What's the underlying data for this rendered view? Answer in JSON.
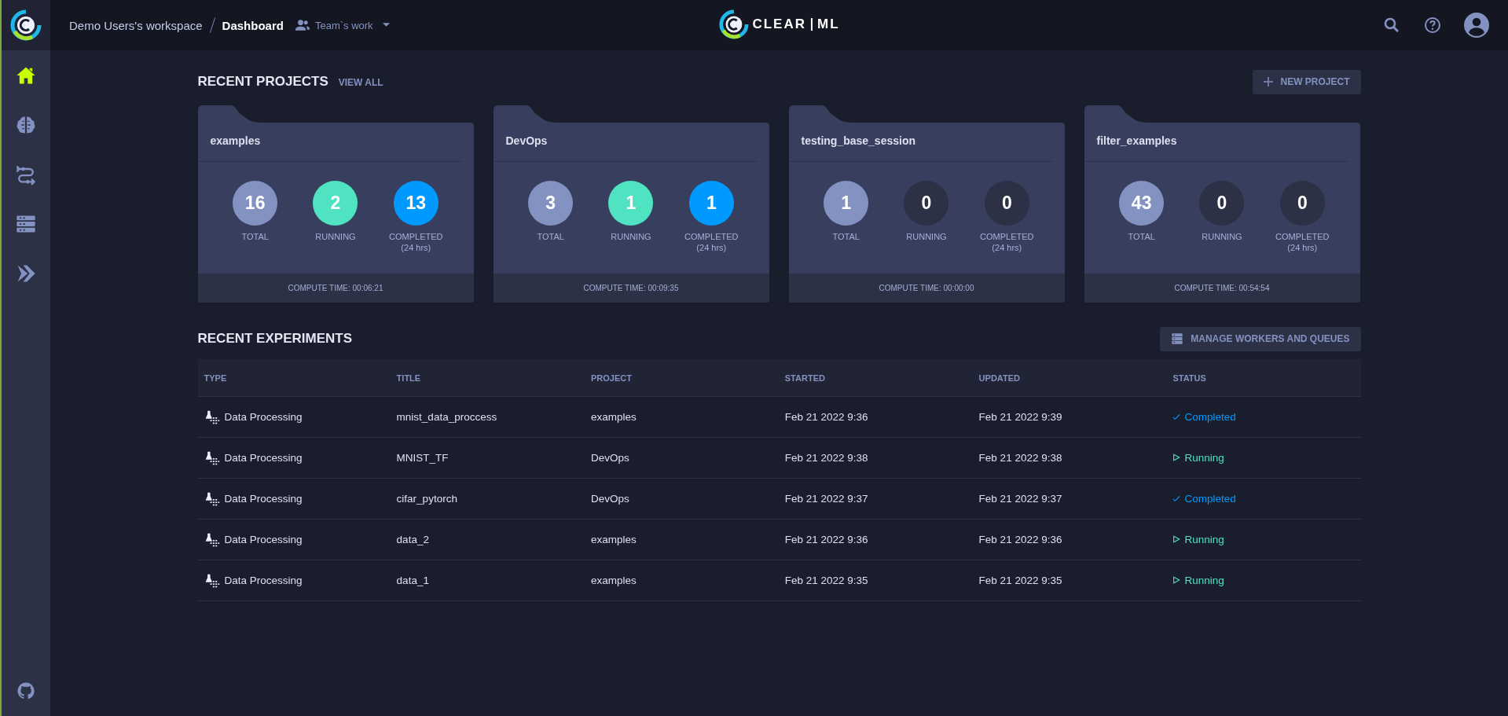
{
  "sidebar": {
    "items": [
      {
        "kind": "home",
        "selected": true
      },
      {
        "kind": "brain",
        "selected": false
      },
      {
        "kind": "pipeline",
        "selected": false
      },
      {
        "kind": "workers",
        "selected": false
      },
      {
        "kind": "deploy",
        "selected": false
      }
    ]
  },
  "header": {
    "workspace": "Demo Users's workspace",
    "page": "Dashboard",
    "filter": "Team`s work",
    "logo": [
      "CLEAR",
      "ML"
    ]
  },
  "recent_projects": {
    "title": "RECENT PROJECTS",
    "view_all": "VIEW ALL",
    "new_button": "NEW PROJECT",
    "projects": [
      {
        "name": "examples",
        "stats": [
          {
            "value": "16",
            "label": "TOTAL",
            "color": "#8492c2"
          },
          {
            "value": "2",
            "label": "RUNNING",
            "color": "#50e3c2"
          },
          {
            "value": "13",
            "label": "COMPLETED",
            "sub": "(24 hrs)",
            "color": "#009aff"
          }
        ],
        "compute_time": "COMPUTE TIME: 00:06:21"
      },
      {
        "name": "DevOps",
        "stats": [
          {
            "value": "3",
            "label": "TOTAL",
            "color": "#8492c2"
          },
          {
            "value": "1",
            "label": "RUNNING",
            "color": "#50e3c2"
          },
          {
            "value": "1",
            "label": "COMPLETED",
            "sub": "(24 hrs)",
            "color": "#009aff"
          }
        ],
        "compute_time": "COMPUTE TIME: 00:09:35"
      },
      {
        "name": "testing_base_session",
        "stats": [
          {
            "value": "1",
            "label": "TOTAL",
            "color": "#8492c2"
          },
          {
            "value": "0",
            "label": "RUNNING",
            "color": "#2c3146"
          },
          {
            "value": "0",
            "label": "COMPLETED",
            "sub": "(24 hrs)",
            "color": "#2c3146"
          }
        ],
        "compute_time": "COMPUTE TIME: 00:00:00"
      },
      {
        "name": "filter_examples",
        "stats": [
          {
            "value": "43",
            "label": "TOTAL",
            "color": "#8492c2"
          },
          {
            "value": "0",
            "label": "RUNNING",
            "color": "#2c3146"
          },
          {
            "value": "0",
            "label": "COMPLETED",
            "sub": "(24 hrs)",
            "color": "#2c3146"
          }
        ],
        "compute_time": "COMPUTE TIME: 00:54:54"
      }
    ]
  },
  "recent_experiments": {
    "title": "RECENT EXPERIMENTS",
    "manage_button": "MANAGE WORKERS AND QUEUES",
    "columns": [
      "TYPE",
      "TITLE",
      "PROJECT",
      "STARTED",
      "UPDATED",
      "STATUS"
    ],
    "rows": [
      {
        "type": "Data Processing",
        "title": "mnist_data_proccess",
        "project": "examples",
        "started": "Feb 21 2022 9:36",
        "updated": "Feb 21 2022 9:39",
        "status": "Completed",
        "kind": "completed"
      },
      {
        "type": "Data Processing",
        "title": "MNIST_TF",
        "project": "DevOps",
        "started": "Feb 21 2022 9:38",
        "updated": "Feb 21 2022 9:38",
        "status": "Running",
        "kind": "running"
      },
      {
        "type": "Data Processing",
        "title": "cifar_pytorch",
        "project": "DevOps",
        "started": "Feb 21 2022 9:37",
        "updated": "Feb 21 2022 9:37",
        "status": "Completed",
        "kind": "completed"
      },
      {
        "type": "Data Processing",
        "title": "data_2",
        "project": "examples",
        "started": "Feb 21 2022 9:36",
        "updated": "Feb 21 2022 9:36",
        "status": "Running",
        "kind": "running"
      },
      {
        "type": "Data Processing",
        "title": "data_1",
        "project": "examples",
        "started": "Feb 21 2022 9:35",
        "updated": "Feb 21 2022 9:35",
        "status": "Running",
        "kind": "running"
      }
    ]
  }
}
